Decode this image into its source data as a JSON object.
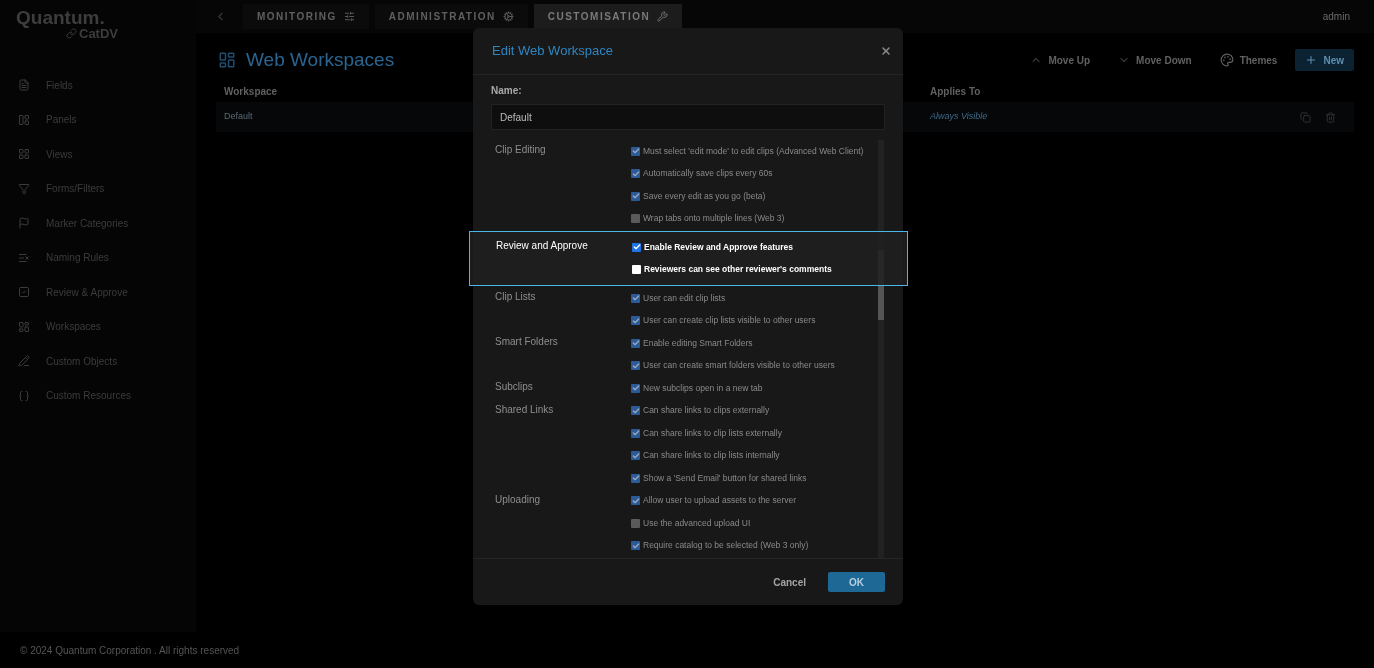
{
  "logo": {
    "brand": "Quantum.",
    "product": "CatDV"
  },
  "nav": {
    "tabs": [
      {
        "label": "MONITORING",
        "selected": false
      },
      {
        "label": "ADMINISTRATION",
        "selected": false
      },
      {
        "label": "CUSTOMISATION",
        "selected": true
      }
    ],
    "user": "admin"
  },
  "sidebar": {
    "items": [
      {
        "label": "Fields"
      },
      {
        "label": "Panels"
      },
      {
        "label": "Views"
      },
      {
        "label": "Forms/Filters"
      },
      {
        "label": "Marker Categories"
      },
      {
        "label": "Naming Rules"
      },
      {
        "label": "Review & Approve"
      },
      {
        "label": "Workspaces"
      },
      {
        "label": "Custom Objects"
      },
      {
        "label": "Custom Resources"
      }
    ]
  },
  "page": {
    "title": "Web Workspaces",
    "toolbar": [
      "Move Up",
      "Move Down",
      "Themes",
      "New"
    ],
    "table": {
      "columns": [
        "Workspace",
        "Applies To"
      ],
      "rows": [
        {
          "workspace": "Default",
          "applies_to": "Always Visible"
        }
      ]
    }
  },
  "dialog": {
    "title": "Edit Web Workspace",
    "name_label": "Name:",
    "name_value": "Default",
    "sections": [
      {
        "title": "Clip Editing",
        "highlighted": false,
        "options": [
          {
            "label": "Must select 'edit mode' to edit clips (Advanced Web Client)",
            "checked": true
          },
          {
            "label": "Automatically save clips every 60s",
            "checked": true
          },
          {
            "label": "Save every edit as you go (beta)",
            "checked": true
          },
          {
            "label": "Wrap tabs onto multiple lines (Web 3)",
            "checked": false
          }
        ]
      },
      {
        "title": "Review and Approve",
        "highlighted": true,
        "options": [
          {
            "label": "Enable Review and Approve features",
            "checked": true
          },
          {
            "label": "Reviewers can see other reviewer's comments",
            "checked": false
          }
        ]
      },
      {
        "title": "Clip Lists",
        "highlighted": false,
        "options": [
          {
            "label": "User can edit clip lists",
            "checked": true
          },
          {
            "label": "User can create clip lists visible to other users",
            "checked": true
          }
        ]
      },
      {
        "title": "Smart Folders",
        "highlighted": false,
        "options": [
          {
            "label": "Enable editing Smart Folders",
            "checked": true
          },
          {
            "label": "User can create smart folders visible to other users",
            "checked": true
          }
        ]
      },
      {
        "title": "Subclips",
        "highlighted": false,
        "options": [
          {
            "label": "New subclips open in a new tab",
            "checked": true
          }
        ]
      },
      {
        "title": "Shared Links",
        "highlighted": false,
        "options": [
          {
            "label": "Can share links to clips externally",
            "checked": true
          },
          {
            "label": "Can share links to clip lists externally",
            "checked": true
          },
          {
            "label": "Can share links to clip lists internally",
            "checked": true
          },
          {
            "label": "Show a 'Send Email' button for shared links",
            "checked": true
          }
        ]
      },
      {
        "title": "Uploading",
        "highlighted": false,
        "options": [
          {
            "label": "Allow user to upload assets to the server",
            "checked": true
          },
          {
            "label": "Use the advanced upload UI",
            "checked": false
          },
          {
            "label": "Require catalog to be selected (Web 3 only)",
            "checked": true
          }
        ]
      }
    ],
    "buttons": [
      "Cancel",
      "OK"
    ]
  },
  "footer": "© 2024 Quantum Corporation . All rights reserved"
}
